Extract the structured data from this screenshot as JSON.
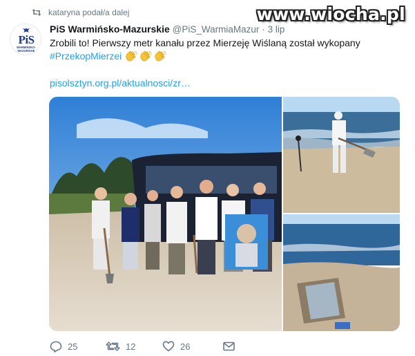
{
  "retweet": {
    "icon": "retweet-icon",
    "label": "kataryna podał/a dalej"
  },
  "watermark": "www.wiocha.pl",
  "author": {
    "avatar_text": "PiS",
    "avatar_subtext": "WARMIŃSKO-MAZURSKIE",
    "name": "PiS Warmińsko-Mazurskie",
    "handle": "@PiS_WarmiaMazur",
    "separator": "·",
    "time": "3 lip"
  },
  "tweet": {
    "text": "Zrobili to! Pierwszy metr kanału przez Mierzeję Wiślaną został wykopany",
    "hashtag": "#PrzekopMierzei",
    "emoji": [
      "clapping-hands",
      "clapping-hands",
      "clapping-hands"
    ],
    "link": "pisolsztyn.org.pl/aktualnosci/zr…"
  },
  "media": {
    "count": 3,
    "photos": [
      "group-with-shovels-and-portrait",
      "man-digging-on-beach",
      "dug-trench-on-beach"
    ]
  },
  "actions": {
    "reply_count": "25",
    "retweet_count": "12",
    "like_count": "26"
  },
  "colors": {
    "link": "#1da1f2",
    "muted": "#657786",
    "text": "#14171a",
    "party_blue": "#1f3c88"
  }
}
